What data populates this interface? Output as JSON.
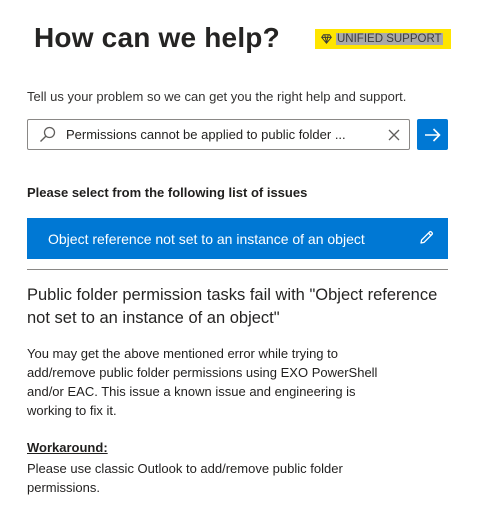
{
  "header": {
    "title": "How can we help?",
    "badge": {
      "label": "UNIFIED SUPPORT",
      "icon": "diamond-icon",
      "color": "#ffe500"
    }
  },
  "intro_text": "Tell us your problem so we can get you the right help and support.",
  "search": {
    "value": "Permissions cannot be applied to public folder ...",
    "search_icon": "search-icon",
    "clear_icon": "close-icon",
    "submit_icon": "arrow-right-icon"
  },
  "issues": {
    "heading": "Please select from the following list of issues",
    "items": [
      {
        "label": "Object reference not set to an instance of an object",
        "icon": "edit-icon",
        "selected": true
      }
    ]
  },
  "article": {
    "title": "Public folder permission tasks fail with \"Object reference not set to an instance of an object\"",
    "body": "You may get the above mentioned error while trying to add/remove public folder permissions using EXO PowerShell and/or EAC. This issue a known issue and engineering is working to fix it.",
    "workaround_label": "Workaround:",
    "workaround_body": "Please use classic Outlook to add/remove public folder permissions."
  },
  "colors": {
    "accent": "#0078d4",
    "badge": "#ffe500"
  }
}
